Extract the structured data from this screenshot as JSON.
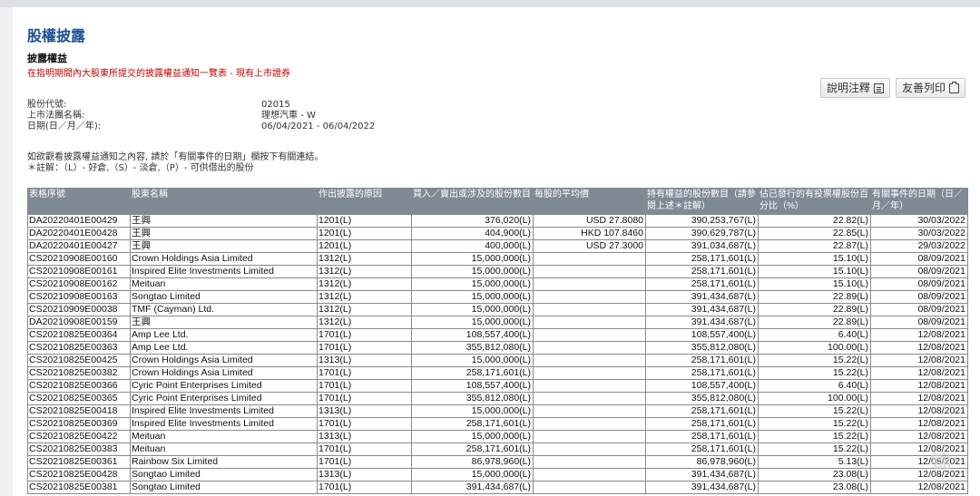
{
  "page": {
    "title": "股權披露",
    "subtitle": "披露權益",
    "notice": "在指明期間內大股東所提交的披露權益通知一覽表 - 現有上市證券"
  },
  "buttons": {
    "notes_label": "說明注釋",
    "print_label": "友善列印"
  },
  "meta": [
    {
      "label": "股份代號:",
      "value": "02015"
    },
    {
      "label": "上市法團名稱:",
      "value": "理想汽車 - W"
    },
    {
      "label": "日期(日／月／年):",
      "value": "06/04/2021 - 06/04/2022"
    }
  ],
  "notes": {
    "line1": "如欲觀看披露權益通知之內容, 請於「有關事件的日期」欄按下有關連結。",
    "line2": "＊註解：（L）- 好倉,（S）- 淡倉,（P）- 可供借出的股份"
  },
  "table": {
    "headers": [
      "表格序號",
      "股東名稱",
      "作出披露的原因",
      "買入／賣出或涉及的股份數目",
      "每股的平均價",
      "持有權益的股份數目（請參閱上述＊註解）",
      "佔已發行的有投票權股份百分比（%）",
      "有關事件的日期（日／月／年）"
    ],
    "rows": [
      [
        "DA20220401E00429",
        "王興",
        "1201(L)",
        "376,020(L)",
        "USD 27.8080",
        "390,253,767(L)",
        "22.82(L)",
        "30/03/2022"
      ],
      [
        "DA20220401E00428",
        "王興",
        "1201(L)",
        "404,900(L)",
        "HKD 107.8460",
        "390,629,787(L)",
        "22.85(L)",
        "30/03/2022"
      ],
      [
        "DA20220401E00427",
        "王興",
        "1201(L)",
        "400,000(L)",
        "USD 27.3000",
        "391,034,687(L)",
        "22.87(L)",
        "29/03/2022"
      ],
      [
        "CS20210908E00160",
        "Crown Holdings Asia Limited",
        "1312(L)",
        "15,000,000(L)",
        "",
        "258,171,601(L)",
        "15.10(L)",
        "08/09/2021"
      ],
      [
        "CS20210908E00161",
        "Inspired Elite Investments Limited",
        "1312(L)",
        "15,000,000(L)",
        "",
        "258,171,601(L)",
        "15.10(L)",
        "08/09/2021"
      ],
      [
        "CS20210908E00162",
        "Meituan",
        "1312(L)",
        "15,000,000(L)",
        "",
        "258,171,601(L)",
        "15.10(L)",
        "08/09/2021"
      ],
      [
        "CS20210908E00163",
        "Songtao Limited",
        "1312(L)",
        "15,000,000(L)",
        "",
        "391,434,687(L)",
        "22.89(L)",
        "08/09/2021"
      ],
      [
        "CS20210909E00038",
        "TMF (Cayman) Ltd.",
        "1312(L)",
        "15,000,000(L)",
        "",
        "391,434,687(L)",
        "22.89(L)",
        "08/09/2021"
      ],
      [
        "DA20210908E00159",
        "王興",
        "1312(L)",
        "15,000,000(L)",
        "",
        "391,434,687(L)",
        "22.89(L)",
        "08/09/2021"
      ],
      [
        "CS20210825E00364",
        "Amp Lee Ltd.",
        "1701(L)",
        "108,557,400(L)",
        "",
        "108,557,400(L)",
        "6.40(L)",
        "12/08/2021"
      ],
      [
        "CS20210825E00363",
        "Amp Lee Ltd.",
        "1701(L)",
        "355,812,080(L)",
        "",
        "355,812,080(L)",
        "100.00(L)",
        "12/08/2021"
      ],
      [
        "CS20210825E00425",
        "Crown Holdings Asia Limited",
        "1313(L)",
        "15,000,000(L)",
        "",
        "258,171,601(L)",
        "15.22(L)",
        "12/08/2021"
      ],
      [
        "CS20210825E00382",
        "Crown Holdings Asia Limited",
        "1701(L)",
        "258,171,601(L)",
        "",
        "258,171,601(L)",
        "15.22(L)",
        "12/08/2021"
      ],
      [
        "CS20210825E00366",
        "Cyric Point Enterprises Limited",
        "1701(L)",
        "108,557,400(L)",
        "",
        "108,557,400(L)",
        "6.40(L)",
        "12/08/2021"
      ],
      [
        "CS20210825E00365",
        "Cyric Point Enterprises Limited",
        "1701(L)",
        "355,812,080(L)",
        "",
        "355,812,080(L)",
        "100.00(L)",
        "12/08/2021"
      ],
      [
        "CS20210825E00418",
        "Inspired Elite Investments Limited",
        "1313(L)",
        "15,000,000(L)",
        "",
        "258,171,601(L)",
        "15.22(L)",
        "12/08/2021"
      ],
      [
        "CS20210825E00369",
        "Inspired Elite Investments Limited",
        "1701(L)",
        "258,171,601(L)",
        "",
        "258,171,601(L)",
        "15.22(L)",
        "12/08/2021"
      ],
      [
        "CS20210825E00422",
        "Meituan",
        "1313(L)",
        "15,000,000(L)",
        "",
        "258,171,601(L)",
        "15.22(L)",
        "12/08/2021"
      ],
      [
        "CS20210825E00383",
        "Meituan",
        "1701(L)",
        "258,171,601(L)",
        "",
        "258,171,601(L)",
        "15.22(L)",
        "12/08/2021"
      ],
      [
        "CS20210825E00361",
        "Rainbow Six Limited",
        "1701(L)",
        "86,978,960(L)",
        "",
        "86,978,960(L)",
        "5.13(L)",
        "12/08/2021"
      ],
      [
        "CS20210825E00428",
        "Songtao Limited",
        "1313(L)",
        "15,000,000(L)",
        "",
        "391,434,687(L)",
        "23.08(L)",
        "12/08/2021"
      ],
      [
        "CS20210825E00381",
        "Songtao Limited",
        "1701(L)",
        "391,434,687(L)",
        "",
        "391,434,687(L)",
        "23.08(L)",
        "12/08/2021"
      ]
    ]
  }
}
